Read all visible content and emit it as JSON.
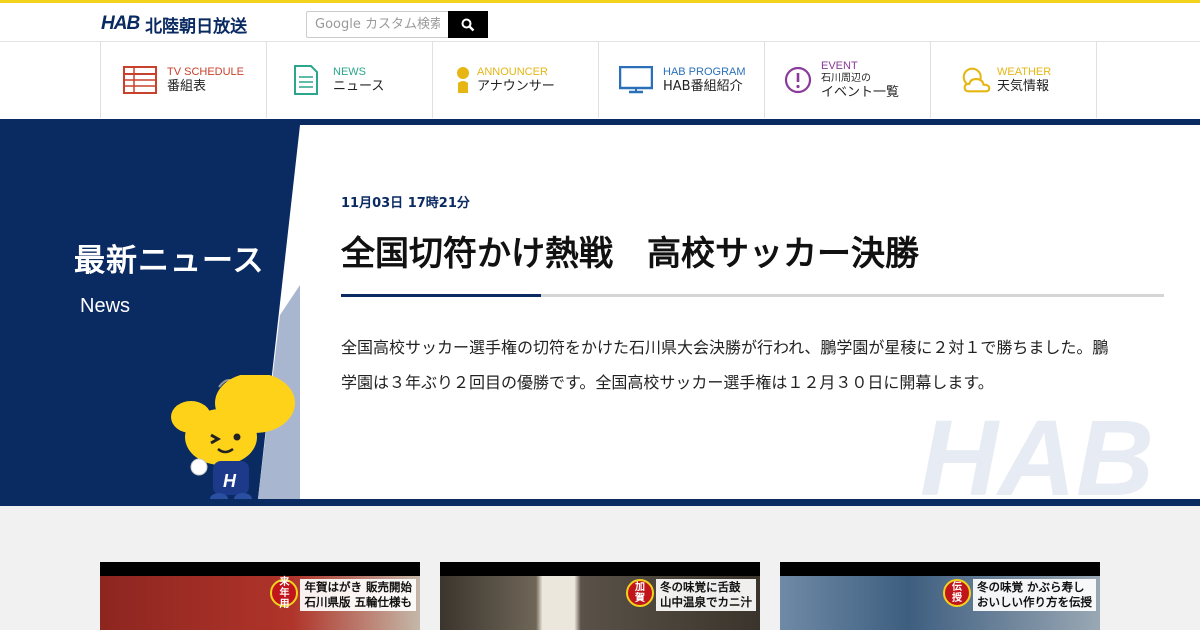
{
  "header": {
    "logo_mark": "HAB",
    "logo_text": "北陸朝日放送",
    "search_placeholder": "Google カスタム検索"
  },
  "nav": [
    {
      "en": "TV SCHEDULE",
      "ja": "番組表",
      "color": "#c9402c",
      "icon": "tv-schedule-icon"
    },
    {
      "en": "NEWS",
      "ja": "ニュース",
      "color": "#2ba58b",
      "icon": "news-icon"
    },
    {
      "en": "ANNOUNCER",
      "ja": "アナウンサー",
      "color": "#e5b614",
      "icon": "announcer-icon"
    },
    {
      "en": "HAB PROGRAM",
      "ja": "HAB番組紹介",
      "color": "#2a70b8",
      "icon": "monitor-icon"
    },
    {
      "en": "EVENT",
      "ja_small": "石川周辺の",
      "ja": "イベント一覧",
      "color": "#8a3a9a",
      "icon": "event-icon"
    },
    {
      "en": "WEATHER",
      "ja": "天気情報",
      "color": "#e5b614",
      "icon": "weather-icon"
    }
  ],
  "hero": {
    "section_title": "最新ニュース",
    "section_sub": "News",
    "date": "11月03日 17時21分",
    "title": "全国切符かけ熱戦　高校サッカー決勝",
    "body": "全国高校サッカー選手権の切符をかけた石川県大会決勝が行われ、鵬学園が星稜に２対１で勝ちました。鵬学園は３年ぶり２回目の優勝です。全国高校サッカー選手権は１２月３０日に開幕します。",
    "watermark": "HAB"
  },
  "cards": [
    {
      "badge": [
        "来",
        "年",
        "用"
      ],
      "lines": [
        "年賀はがき 販売開始",
        "石川県版 五輪仕様も"
      ],
      "bg": "#9a2a22"
    },
    {
      "badge": [
        "加",
        "賀"
      ],
      "lines": [
        "冬の味覚に舌鼓",
        "山中温泉でカニ汁"
      ],
      "bg": "#3f3a33"
    },
    {
      "badge": [
        "伝",
        "授"
      ],
      "lines": [
        "冬の味覚 かぶら寿し",
        "おいしい作り方を伝授"
      ],
      "bg": "#4a6a8a"
    }
  ],
  "colors": {
    "brand_navy": "#0a2a62",
    "brand_yellow": "#f2d21b"
  }
}
